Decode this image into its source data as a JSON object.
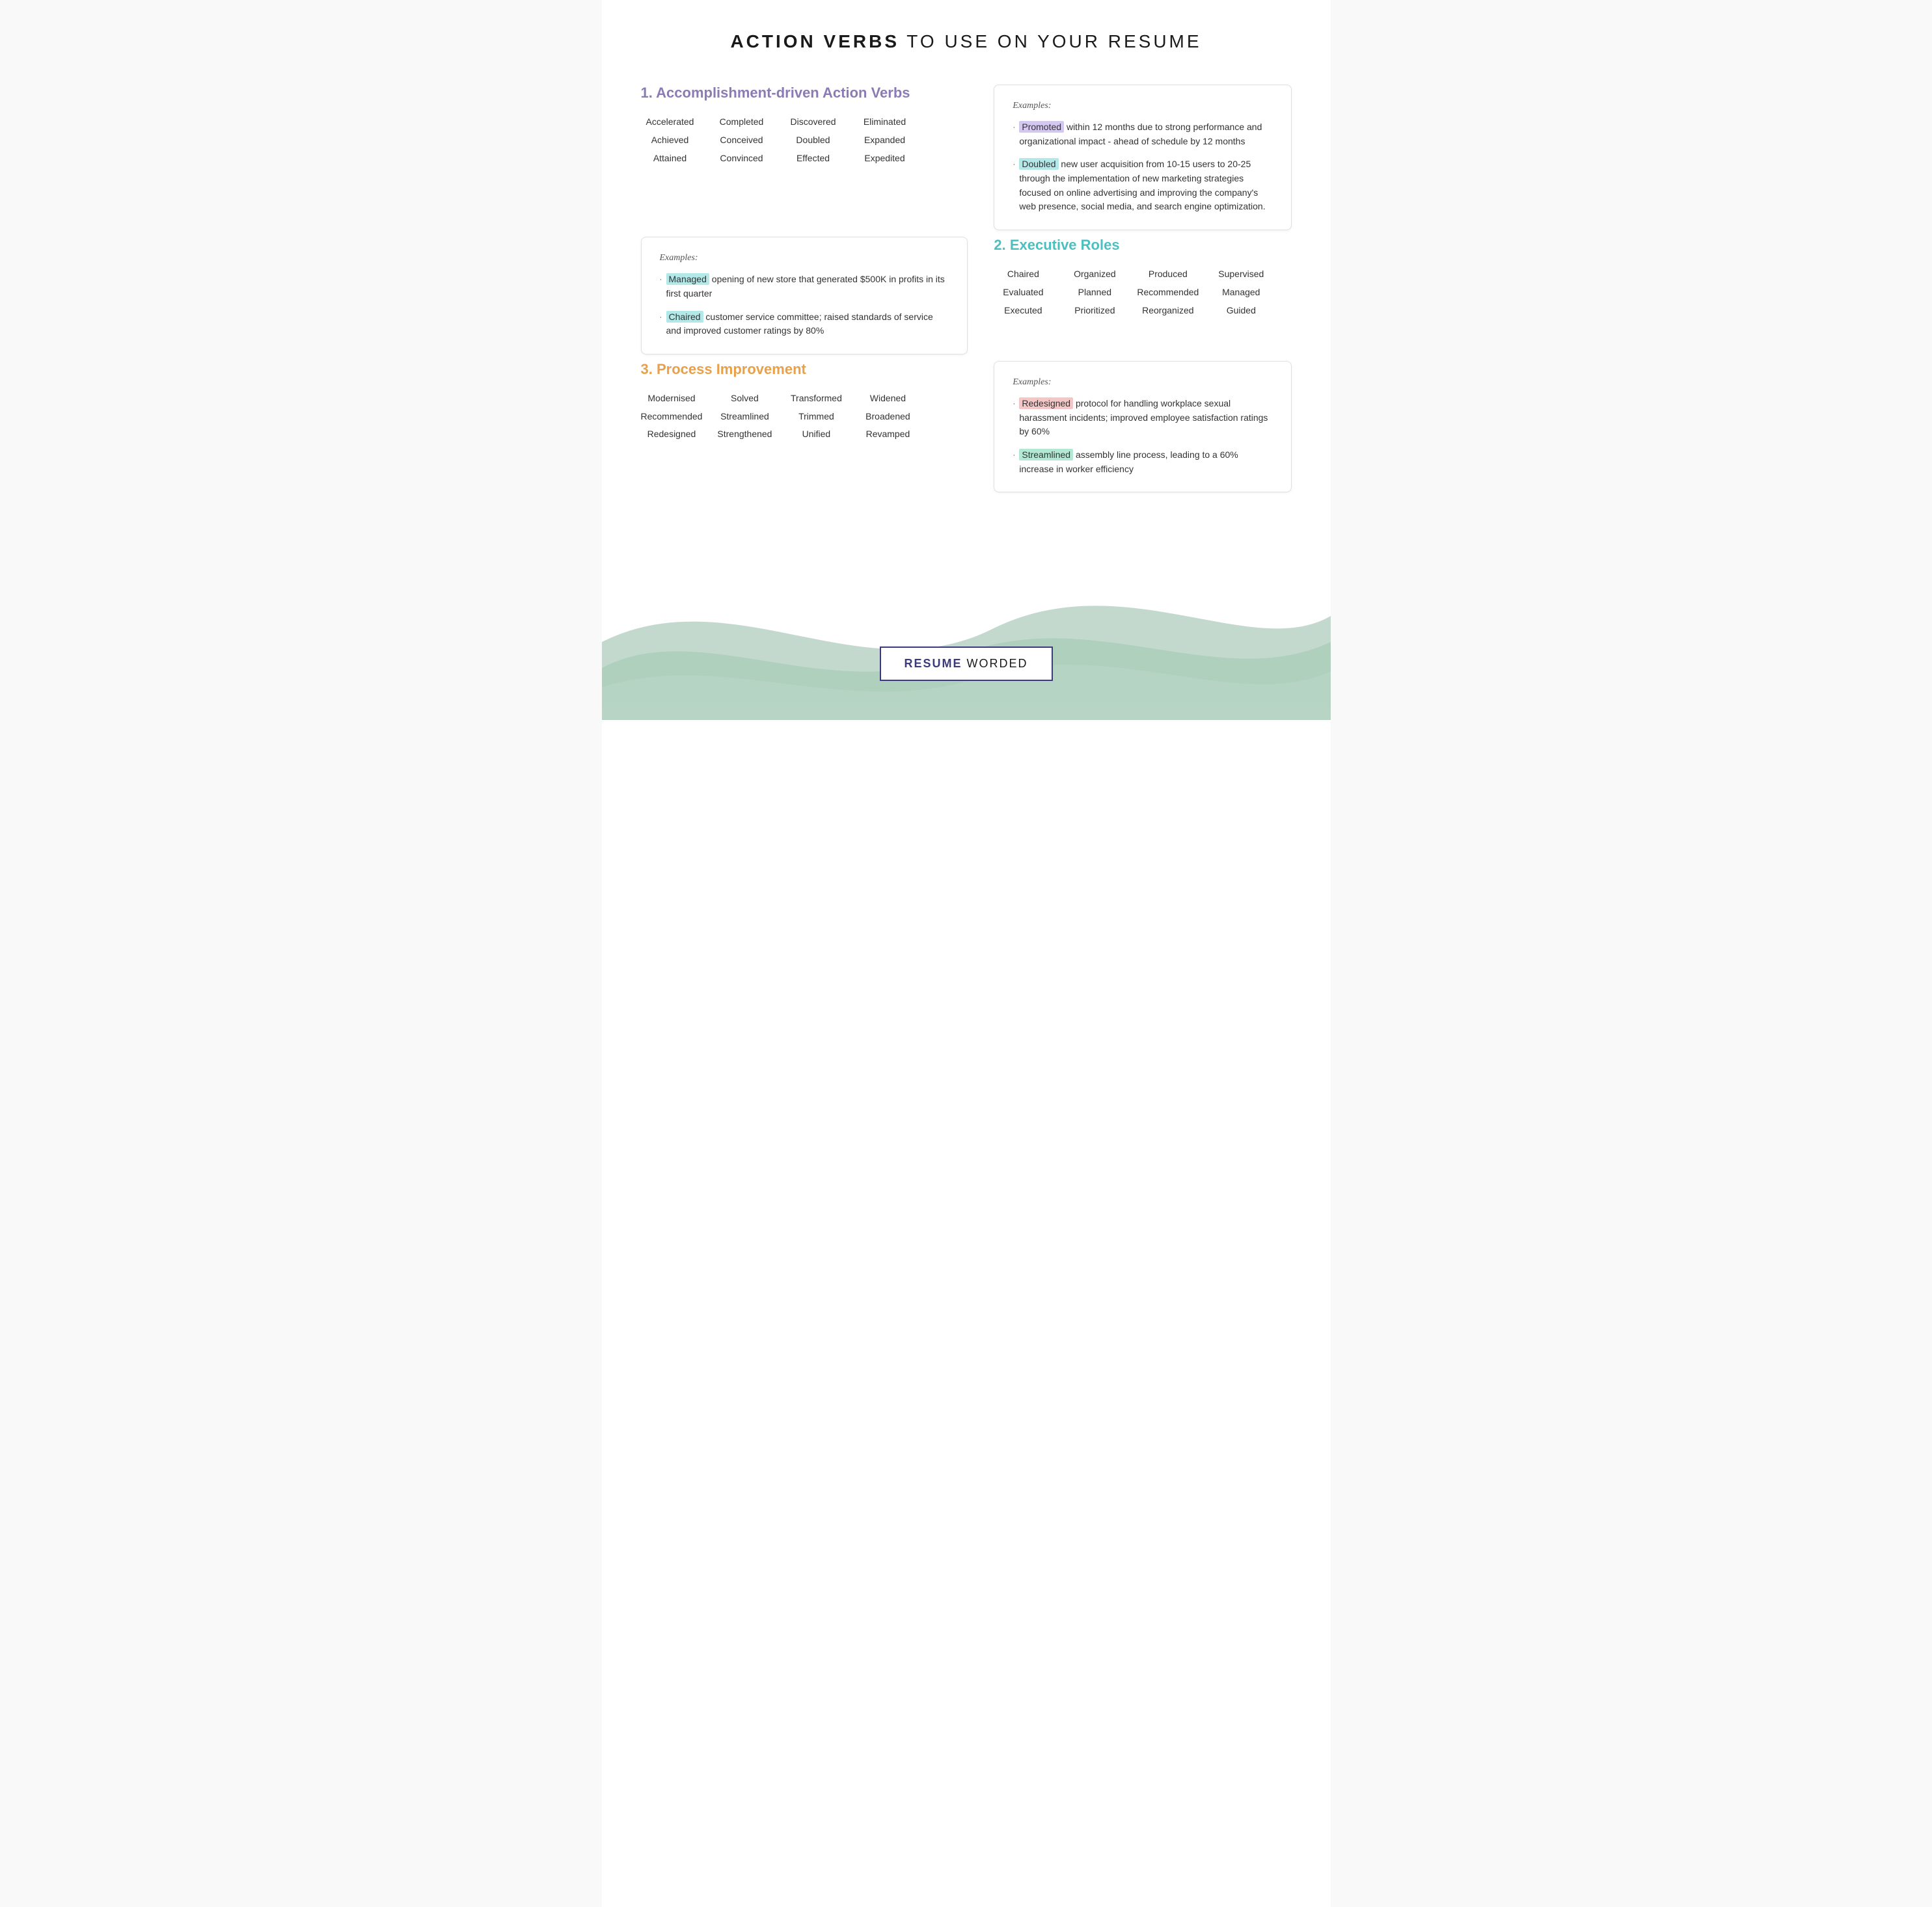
{
  "header": {
    "title_bold": "ACTION VERBS",
    "title_rest": " TO USE ON YOUR RESUME"
  },
  "section1": {
    "title": "1. Accomplishment-driven Action Verbs",
    "words": [
      [
        "Accelerated",
        "Achieved",
        "Attained"
      ],
      [
        "Completed",
        "Conceived",
        "Convinced"
      ],
      [
        "Discovered",
        "Doubled",
        "Effected"
      ],
      [
        "Eliminated",
        "Expanded",
        "Expedited"
      ]
    ],
    "examples_label": "Examples:",
    "examples": [
      {
        "highlight": "Promoted",
        "highlight_class": "hl-purple",
        "text": " within 12 months due to strong performance and organizational impact - ahead of schedule by 12 months"
      },
      {
        "highlight": "Doubled",
        "highlight_class": "hl-teal",
        "text": " new user acquisition from 10-15 users to 20-25 through the implementation of new marketing strategies focused on online advertising and improving the company's web presence, social media, and search engine optimization."
      }
    ],
    "examples2_label": "Examples:",
    "examples2": [
      {
        "highlight": "Managed",
        "highlight_class": "hl-teal",
        "text": " opening of new store that generated $500K in profits in its first quarter"
      },
      {
        "highlight": "Chaired",
        "highlight_class": "hl-teal",
        "text": " customer service committee; raised standards of service and improved customer ratings by 80%"
      }
    ]
  },
  "section2": {
    "title": "2. Executive Roles",
    "words": [
      [
        "Chaired",
        "Evaluated",
        "Executed"
      ],
      [
        "Organized",
        "Planned",
        "Prioritized"
      ],
      [
        "Produced",
        "Recommended",
        "Reorganized"
      ],
      [
        "Supervised",
        "Managed",
        "Guided"
      ]
    ]
  },
  "section3": {
    "title": "3. Process Improvement",
    "words": [
      [
        "Modernised",
        "Recommended",
        "Redesigned"
      ],
      [
        "Solved",
        "Streamlined",
        "Strengthened"
      ],
      [
        "Transformed",
        "Trimmed",
        "Unified"
      ],
      [
        "Widened",
        "Broadened",
        "Revamped"
      ]
    ],
    "examples_label": "Examples:",
    "examples": [
      {
        "highlight": "Redesigned",
        "highlight_class": "hl-pink",
        "text": " protocol for handling workplace sexual harassment incidents; improved employee satisfaction ratings by 60%"
      },
      {
        "highlight": "Streamlined",
        "highlight_class": "hl-green",
        "text": " assembly line process, leading to a 60% increase in worker efficiency"
      }
    ]
  },
  "branding": {
    "bold": "RESUME",
    "rest": " WORDED"
  }
}
